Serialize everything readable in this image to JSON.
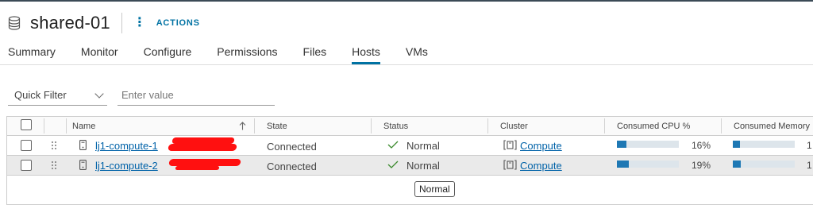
{
  "datastore": {
    "title": "shared-01",
    "icon": "database-icon"
  },
  "actions": {
    "label": "ACTIONS",
    "icon": "vertical-ellipsis-icon"
  },
  "tabs": [
    {
      "label": "Summary",
      "active": false
    },
    {
      "label": "Monitor",
      "active": false
    },
    {
      "label": "Configure",
      "active": false
    },
    {
      "label": "Permissions",
      "active": false
    },
    {
      "label": "Files",
      "active": false
    },
    {
      "label": "Hosts",
      "active": true
    },
    {
      "label": "VMs",
      "active": false
    }
  ],
  "filter": {
    "label": "Quick Filter",
    "placeholder": "Enter value",
    "value": ""
  },
  "table": {
    "columns": {
      "name": "Name",
      "state": "State",
      "status": "Status",
      "cluster": "Cluster",
      "cpu": "Consumed CPU %",
      "memory": "Consumed Memory"
    },
    "sort": {
      "column": "name",
      "direction": "ascending",
      "icon": "arrow-up-icon"
    },
    "rows": [
      {
        "name": "lj1-compute-1",
        "state": "Connected",
        "status": "Normal",
        "cluster": "Compute",
        "cpu_percent": 16,
        "cpu_label": "16%",
        "memory_label": "1",
        "memory_fraction": 0.12,
        "selected": false
      },
      {
        "name": "lj1-compute-2",
        "state": "Connected",
        "status": "Normal",
        "cluster": "Compute",
        "cpu_percent": 19,
        "cpu_label": "19%",
        "memory_label": "1",
        "memory_fraction": 0.13,
        "selected": true
      }
    ]
  },
  "tooltip": {
    "text": "Normal"
  },
  "colors": {
    "accent": "#0072a3",
    "link": "#0062a8",
    "bar_fill": "#1e78b4",
    "status_ok": "#3c8a2e",
    "redaction": "#ff1010"
  }
}
